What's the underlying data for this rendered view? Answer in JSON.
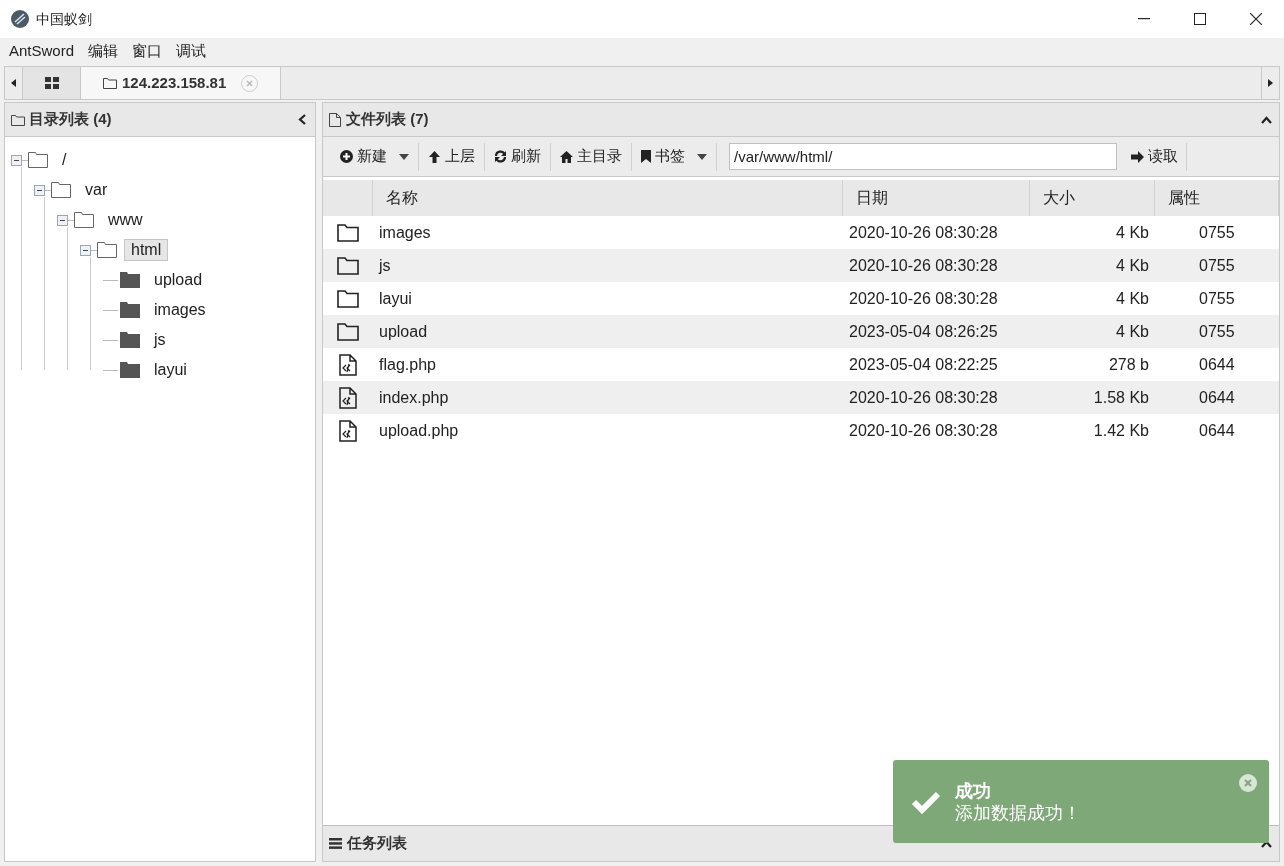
{
  "window": {
    "title": "中国蚁剑"
  },
  "menu": [
    "AntSword",
    "编辑",
    "窗口",
    "调试"
  ],
  "tabs": [
    {
      "kind": "home",
      "selected": false
    },
    {
      "kind": "host",
      "label": "124.223.158.81",
      "selected": true
    }
  ],
  "dir_panel": {
    "title": "目录列表 (4)",
    "tree": [
      {
        "name": "/",
        "expanded": true,
        "selected": false,
        "children": [
          {
            "name": "var",
            "expanded": true,
            "selected": false,
            "children": [
              {
                "name": "www",
                "expanded": true,
                "selected": false,
                "children": [
                  {
                    "name": "html",
                    "expanded": true,
                    "selected": true,
                    "children": [
                      {
                        "name": "upload",
                        "expanded": false,
                        "selected": false
                      },
                      {
                        "name": "images",
                        "expanded": false,
                        "selected": false
                      },
                      {
                        "name": "js",
                        "expanded": false,
                        "selected": false
                      },
                      {
                        "name": "layui",
                        "expanded": false,
                        "selected": false
                      }
                    ]
                  }
                ]
              }
            ]
          }
        ]
      }
    ]
  },
  "file_panel": {
    "title": "文件列表 (7)",
    "toolbar": [
      {
        "kind": "new",
        "label": "新建",
        "dropdown": true
      },
      {
        "kind": "up",
        "label": "上层",
        "dropdown": false
      },
      {
        "kind": "refresh",
        "label": "刷新",
        "dropdown": false
      },
      {
        "kind": "home",
        "label": "主目录",
        "dropdown": false
      },
      {
        "kind": "bookmark",
        "label": "书签",
        "dropdown": true
      }
    ],
    "path": "/var/www/html/",
    "read_button": "读取",
    "columns": [
      "名称",
      "日期",
      "大小",
      "属性"
    ],
    "rows": [
      {
        "kind": "folder",
        "name": "images",
        "date": "2020-10-26 08:30:28",
        "size": "4 Kb",
        "mode": "0755"
      },
      {
        "kind": "folder",
        "name": "js",
        "date": "2020-10-26 08:30:28",
        "size": "4 Kb",
        "mode": "0755"
      },
      {
        "kind": "folder",
        "name": "layui",
        "date": "2020-10-26 08:30:28",
        "size": "4 Kb",
        "mode": "0755"
      },
      {
        "kind": "folder",
        "name": "upload",
        "date": "2023-05-04 08:26:25",
        "size": "4 Kb",
        "mode": "0755"
      },
      {
        "kind": "file",
        "name": "flag.php",
        "date": "2023-05-04 08:22:25",
        "size": "278 b",
        "mode": "0644"
      },
      {
        "kind": "file",
        "name": "index.php",
        "date": "2020-10-26 08:30:28",
        "size": "1.58 Kb",
        "mode": "0644"
      },
      {
        "kind": "file",
        "name": "upload.php",
        "date": "2020-10-26 08:30:28",
        "size": "1.42 Kb",
        "mode": "0644"
      }
    ]
  },
  "task_panel": {
    "title": "任务列表"
  },
  "toast": {
    "title": "成功",
    "message": "添加数据成功！"
  }
}
